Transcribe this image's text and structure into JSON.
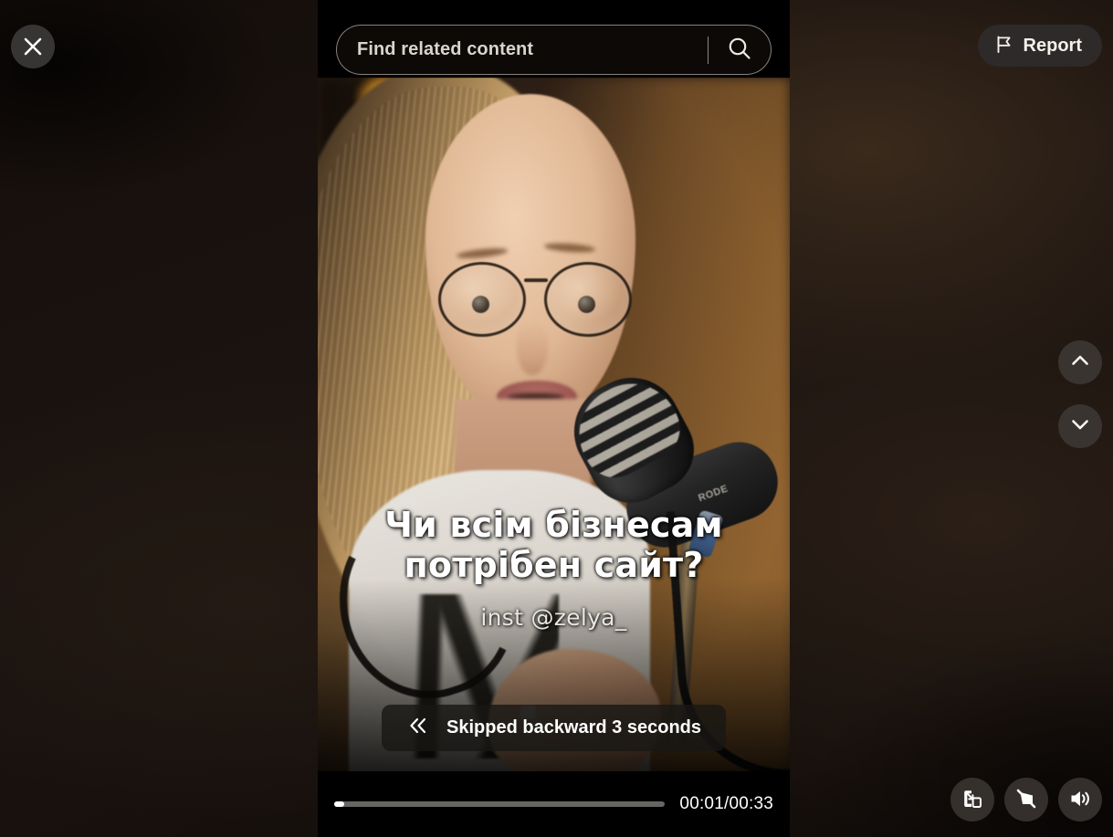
{
  "overlay": {
    "close_icon": "close-x-icon"
  },
  "search": {
    "placeholder": "Find related content",
    "value": "",
    "submit_icon": "search-magnifier-icon"
  },
  "report": {
    "label": "Report",
    "icon": "flag-icon"
  },
  "navigation": {
    "previous_icon": "chevron-up-icon",
    "next_icon": "chevron-down-icon"
  },
  "video": {
    "burned_caption": "Чи всім бізнесам потрібен сайт?",
    "burned_handle": "inst @zelya_",
    "mic_brand": "RODE"
  },
  "toast": {
    "icon": "double-chevron-left-icon",
    "message": "Skipped backward 3 seconds"
  },
  "player": {
    "current_time": "00:01",
    "duration": "00:33",
    "time_display": "00:01/00:33",
    "progress_percent": 3
  },
  "controls": [
    {
      "name": "miniplayer-button",
      "icon": "miniplayer-icon"
    },
    {
      "name": "autoplay-off-button",
      "icon": "autoplay-off-icon"
    },
    {
      "name": "volume-button",
      "icon": "volume-high-icon"
    }
  ],
  "colors": {
    "backdrop": "#140e0b",
    "panel_black": "#000000",
    "button_fill": "#3e3a36",
    "text_primary": "#ffffff",
    "progress_fill": "#ffffff",
    "progress_track": "#bebab4"
  }
}
